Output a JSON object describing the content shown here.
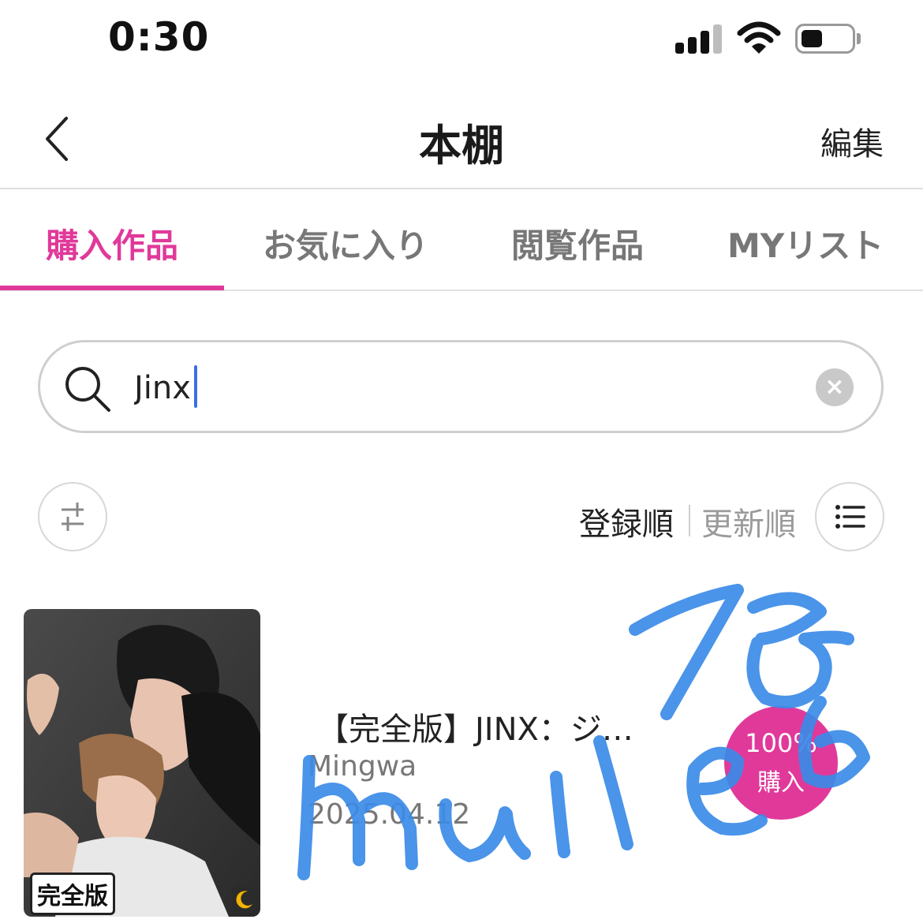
{
  "status_bar": {
    "time": "0:30",
    "signal_icon": "cellular-signal-icon",
    "wifi_icon": "wifi-icon",
    "battery_icon": "battery-icon",
    "battery_level": 0.35
  },
  "header": {
    "back_icon": "chevron-left-icon",
    "title": "本棚",
    "edit_label": "編集"
  },
  "tabs": [
    {
      "label": "購入作品",
      "active": true
    },
    {
      "label": "お気に入り",
      "active": false
    },
    {
      "label": "閲覧作品",
      "active": false
    },
    {
      "label": "MYリスト",
      "active": false
    }
  ],
  "search": {
    "value": "Jinx",
    "clear_label": "×"
  },
  "sort": {
    "options": [
      "登録順",
      "更新順"
    ],
    "selected": "登録順"
  },
  "books": [
    {
      "badge": "完全版",
      "title": "【完全版】JINX：ジ…",
      "author": "Mingwa",
      "date": "2025.04.12",
      "progress_percent": "100%",
      "progress_label": "購入",
      "moon_icon": "moon-icon"
    }
  ],
  "colors": {
    "accent": "#e0399a",
    "caret": "#3d6fe0",
    "scribble": "#3b8be8"
  }
}
